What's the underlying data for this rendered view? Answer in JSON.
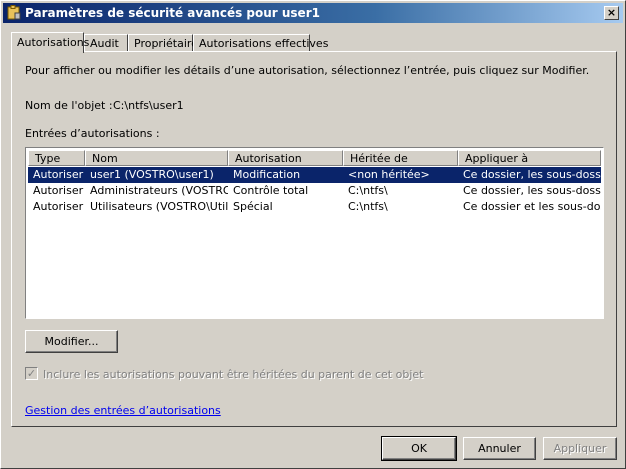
{
  "window": {
    "title": "Paramètres de sécurité avancés pour user1",
    "close_glyph": "×"
  },
  "tabs": [
    {
      "label": "Autorisations",
      "active": true
    },
    {
      "label": "Audit"
    },
    {
      "label": "Propriétaire"
    },
    {
      "label": "Autorisations effectives"
    }
  ],
  "panel": {
    "instructions": "Pour afficher ou modifier les détails d’une autorisation, sélectionnez l’entrée, puis cliquez sur Modifier.",
    "object_name_label": "Nom de l'objet :",
    "object_name_value": "C:\\ntfs\\user1",
    "entries_label": "Entrées d’autorisations :"
  },
  "table": {
    "columns": [
      "Type",
      "Nom",
      "Autorisation",
      "Héritée de",
      "Appliquer à"
    ],
    "rows": [
      {
        "type": "Autoriser",
        "name": "user1 (VOSTRO\\user1)",
        "permission": "Modification",
        "inherited_from": "<non héritée>",
        "apply_to": "Ce dossier, les sous-dossi...",
        "selected": true
      },
      {
        "type": "Autoriser",
        "name": "Administrateurs (VOSTRO...",
        "permission": "Contrôle total",
        "inherited_from": "C:\\ntfs\\",
        "apply_to": "Ce dossier, les sous-dossi..."
      },
      {
        "type": "Autoriser",
        "name": "Utilisateurs (VOSTRO\\Util...",
        "permission": "Spécial",
        "inherited_from": "C:\\ntfs\\",
        "apply_to": "Ce dossier et les sous-dos..."
      }
    ]
  },
  "buttons": {
    "modify": "Modifier...",
    "ok": "OK",
    "cancel": "Annuler",
    "apply": "Appliquer"
  },
  "inherit_checkbox": {
    "label": "Inclure les autorisations pouvant être héritées du parent de cet objet",
    "checked": true,
    "enabled": false
  },
  "help_link": "Gestion des entrées d’autorisations",
  "icons": {
    "title": "folder-lock-icon",
    "check": "checkmark-icon"
  },
  "colors": {
    "titlebar_start": "#0a246a",
    "selection": "#0a246a",
    "face": "#d4d0c8"
  }
}
